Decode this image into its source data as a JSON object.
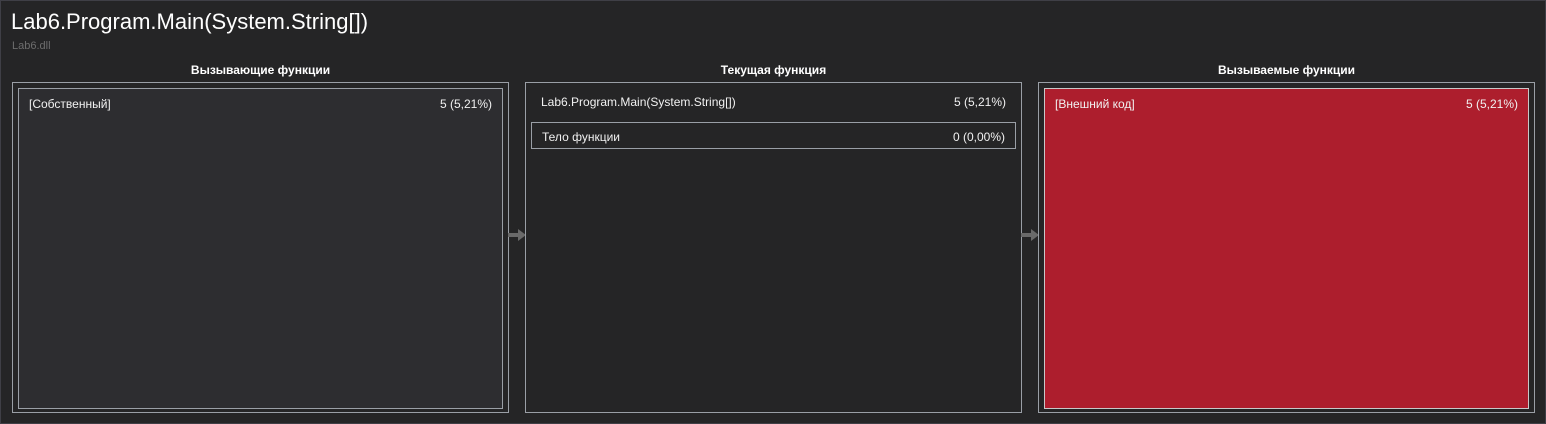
{
  "header": {
    "title": "Lab6.Program.Main(System.String[])",
    "module": "Lab6.dll"
  },
  "columns": {
    "callers": {
      "heading": "Вызывающие функции",
      "items": [
        {
          "label": "[Собственный]",
          "value": "5 (5,21%)"
        }
      ]
    },
    "current": {
      "heading": "Текущая функция",
      "function_label": "Lab6.Program.Main(System.String[])",
      "function_value": "5 (5,21%)",
      "body_label": "Тело функции",
      "body_value": "0 (0,00%)"
    },
    "callees": {
      "heading": "Вызываемые функции",
      "items": [
        {
          "label": "[Внешний код]",
          "value": "5 (5,21%)"
        }
      ]
    }
  },
  "colors": {
    "background": "#252526",
    "caller_block": "#2d2d30",
    "callee_block_hot": "#ad1e2d",
    "border": "#9a9fa6"
  },
  "icons": {
    "flow_arrow": "arrow-right-icon"
  }
}
